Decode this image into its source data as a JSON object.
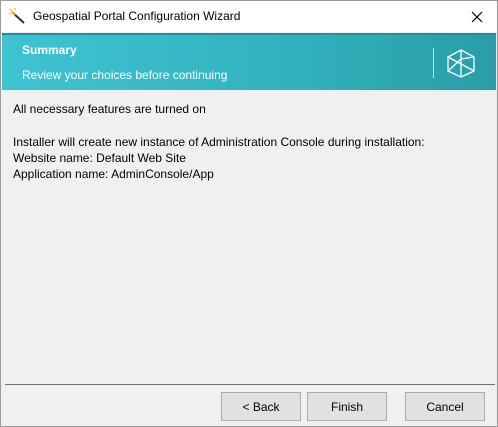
{
  "window": {
    "title": "Geospatial Portal Configuration Wizard",
    "close_glyph": "✕"
  },
  "banner": {
    "title": "Summary",
    "subtitle": "Review your choices before continuing",
    "logo_icon": "geospatial-logo-icon"
  },
  "summary": {
    "features_status": "All necessary features are turned on",
    "installer_note": "Installer will create new instance of Administration Console during installation:",
    "website_name": "Website name: Default Web Site",
    "application_name": "Application name: AdminConsole/App"
  },
  "buttons": {
    "back_label": "< Back",
    "finish_label": "Finish",
    "cancel_label": "Cancel"
  },
  "colors": {
    "banner_accent": "#33b3bf",
    "content_background": "#f0f0f0"
  }
}
